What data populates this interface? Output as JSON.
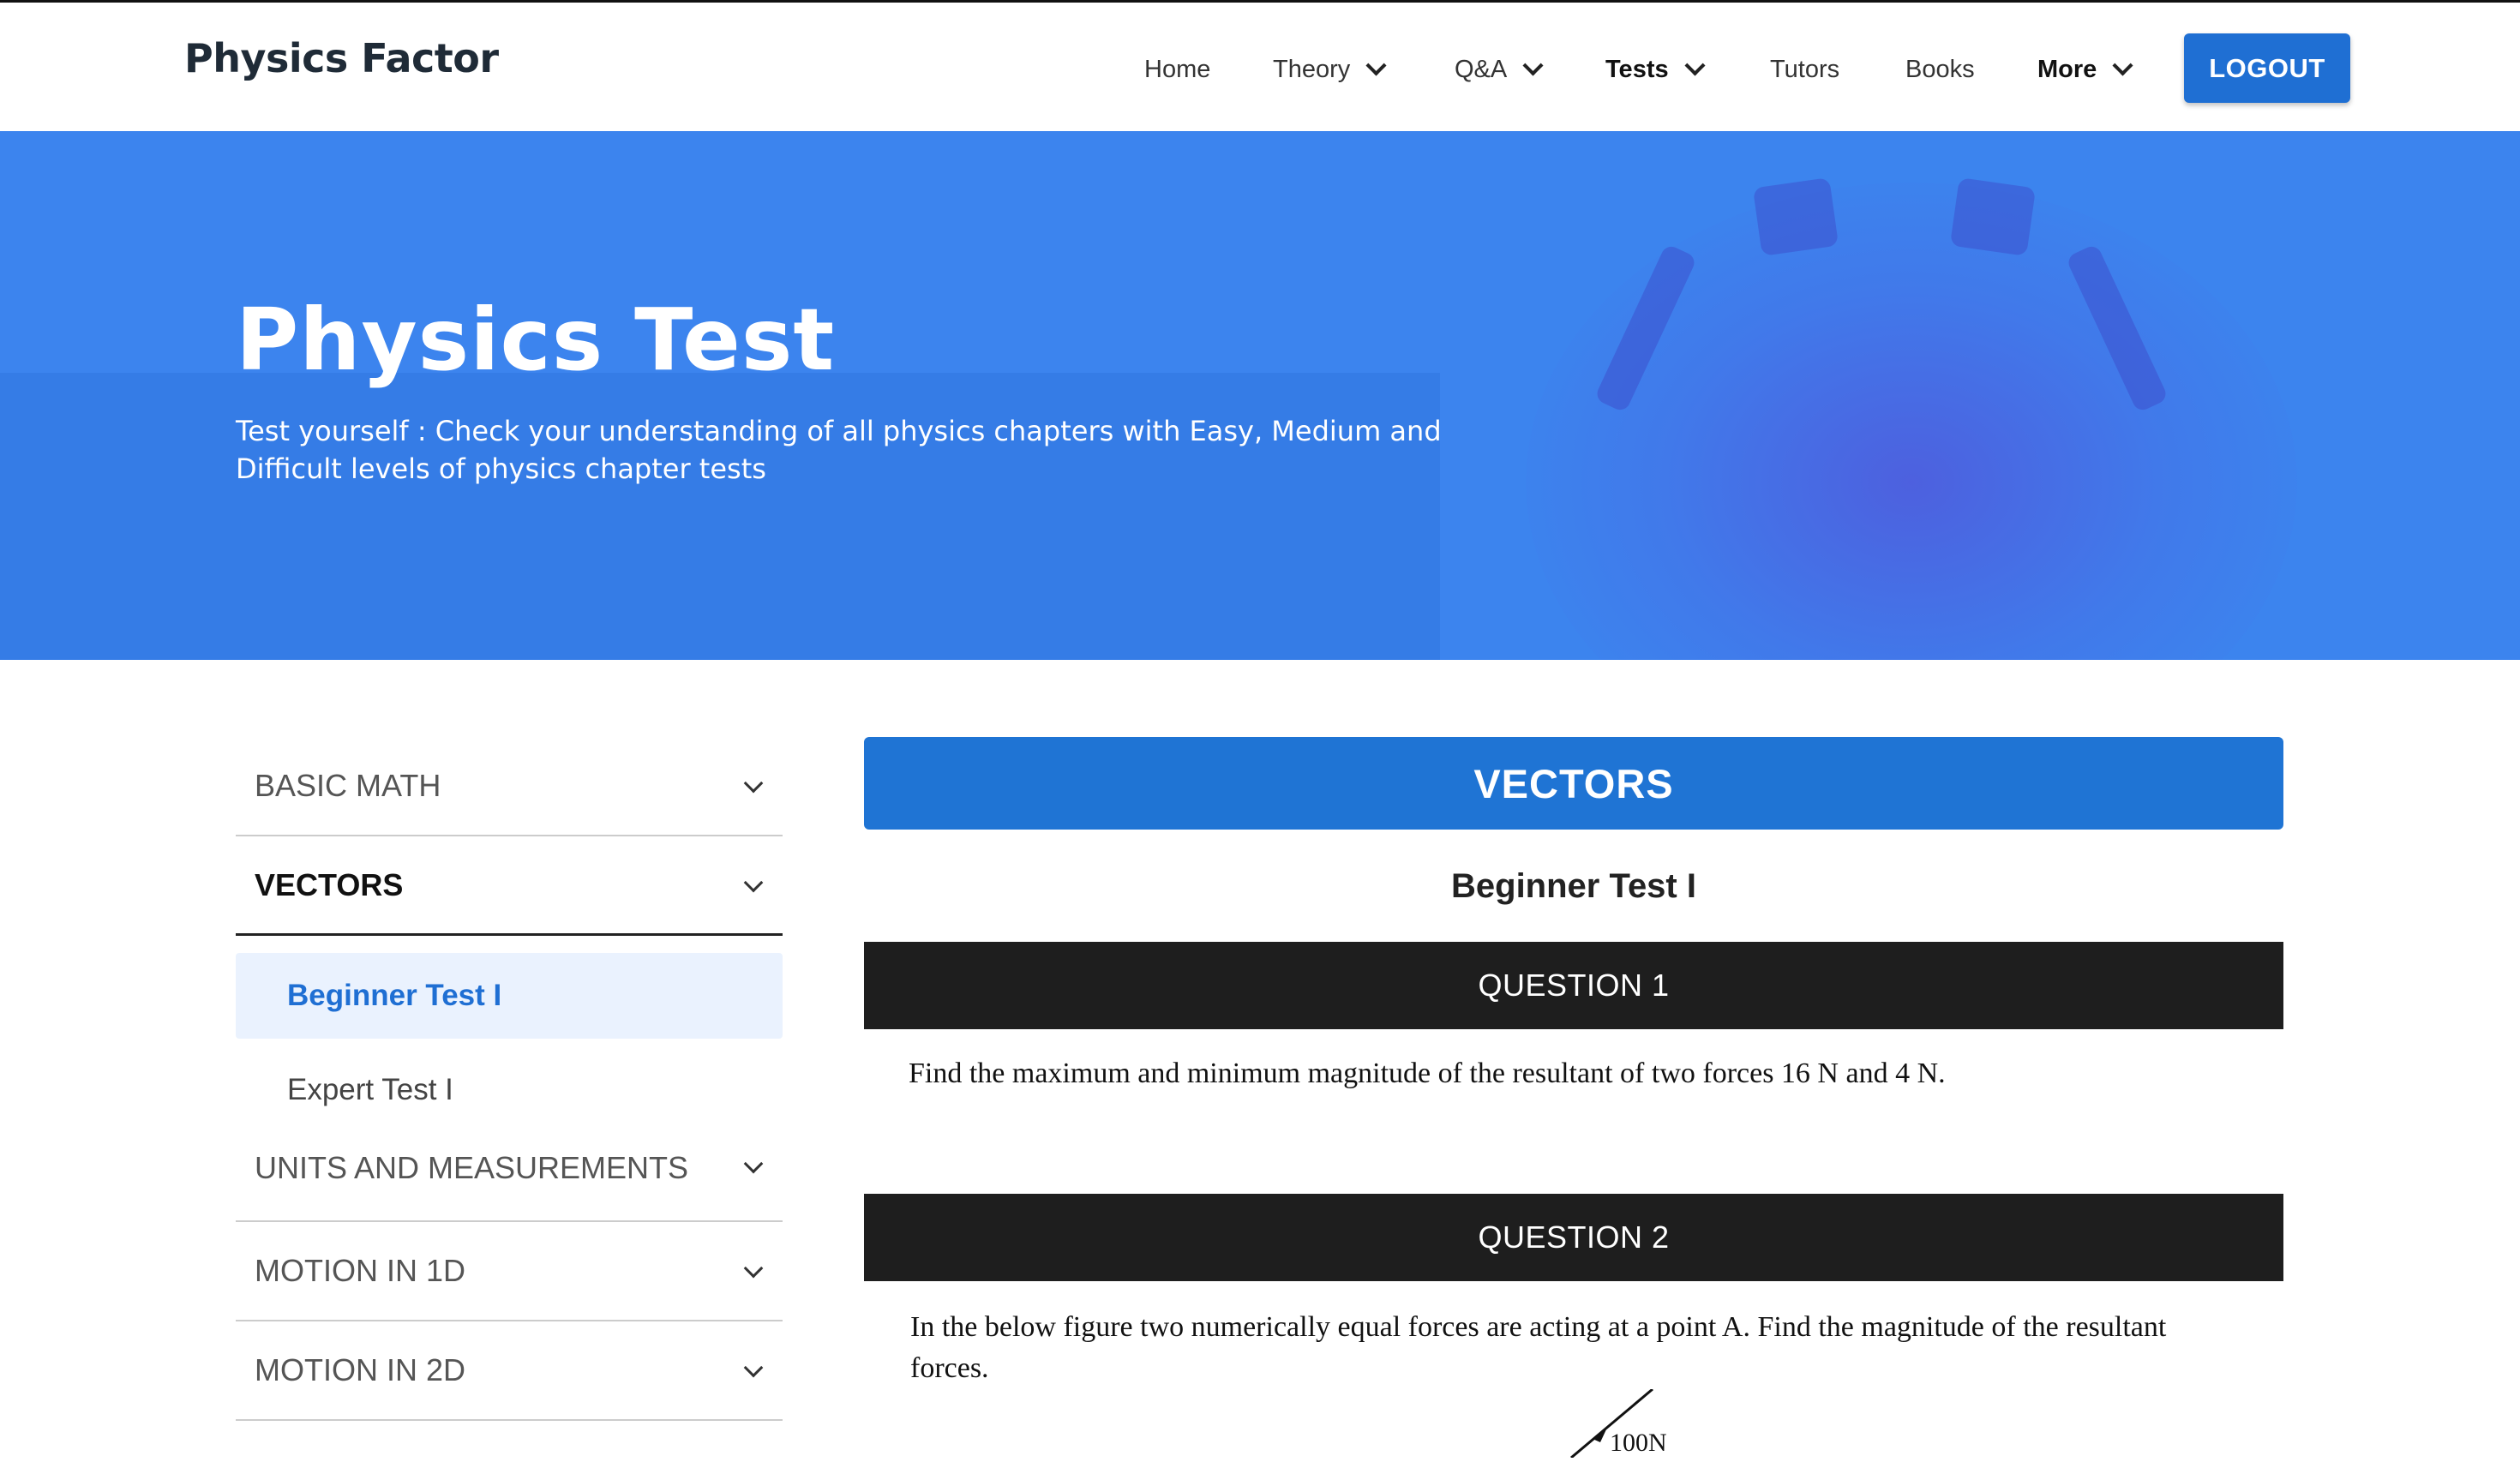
{
  "header": {
    "logo": "Physics Factor",
    "nav": [
      {
        "label": "Home",
        "dropdown": false,
        "bold": false
      },
      {
        "label": "Theory",
        "dropdown": true,
        "bold": false
      },
      {
        "label": "Q&A",
        "dropdown": true,
        "bold": false
      },
      {
        "label": "Tests",
        "dropdown": true,
        "bold": true
      },
      {
        "label": "Tutors",
        "dropdown": false,
        "bold": false
      },
      {
        "label": "Books",
        "dropdown": false,
        "bold": false
      },
      {
        "label": "More",
        "dropdown": true,
        "bold": true
      }
    ],
    "logout_label": "LOGOUT"
  },
  "hero": {
    "title": "Physics Test",
    "subtitle": "Test yourself : Check your understanding of all physics chapters with Easy, Medium and Difficult levels of physics chapter tests"
  },
  "sidebar": {
    "sections": [
      {
        "label": "BASIC MATH",
        "expanded": false
      },
      {
        "label": "VECTORS",
        "expanded": true,
        "items": [
          "Beginner Test I",
          "Expert Test I"
        ],
        "selected": "Beginner Test I"
      },
      {
        "label": "UNITS AND MEASUREMENTS",
        "expanded": false
      },
      {
        "label": "MOTION IN 1D",
        "expanded": false
      },
      {
        "label": "MOTION IN 2D",
        "expanded": false
      }
    ]
  },
  "main": {
    "topic": "VECTORS",
    "test_title": "Beginner Test I",
    "questions": [
      {
        "header": "QUESTION 1",
        "text": "Find the maximum and minimum magnitude of the resultant of two forces 16 N and 4 N."
      },
      {
        "header": "QUESTION 2",
        "text": "In the below figure two numerically equal forces are acting at a point A. Find the magnitude of the resultant forces.",
        "figure_label": "100N"
      }
    ]
  },
  "colors": {
    "brand_blue": "#1f6fd3",
    "hero_blue": "#3c84ee",
    "question_bar": "#1e1e1e",
    "selected_bg": "#eaf2fe"
  }
}
